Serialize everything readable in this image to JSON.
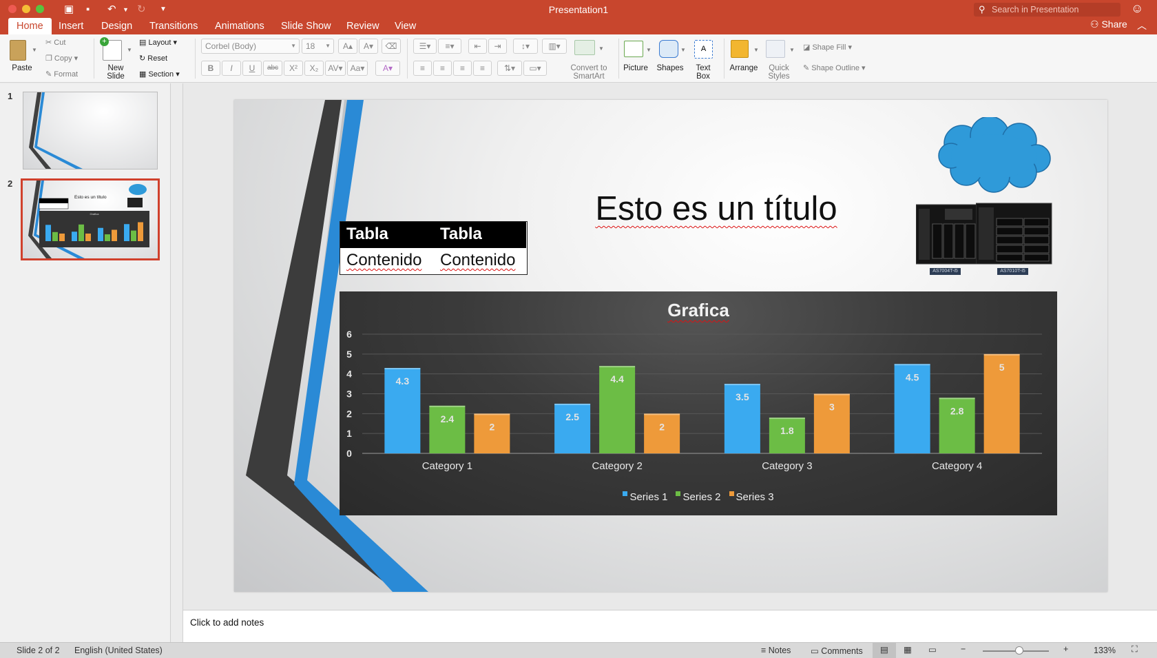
{
  "window": {
    "title": "Presentation1"
  },
  "search": {
    "placeholder": "Search in Presentation"
  },
  "tabs": [
    "Home",
    "Insert",
    "Design",
    "Transitions",
    "Animations",
    "Slide Show",
    "Review",
    "View"
  ],
  "share_label": "Share",
  "ribbon": {
    "paste": "Paste",
    "cut": "Cut",
    "copy": "Copy",
    "format": "Format",
    "new_slide_1": "New",
    "new_slide_2": "Slide",
    "layout": "Layout",
    "reset": "Reset",
    "section": "Section",
    "font_name": "Corbel (Body)",
    "font_size": "18",
    "convert_1": "Convert to",
    "convert_2": "SmartArt",
    "picture": "Picture",
    "shapes": "Shapes",
    "textbox_1": "Text",
    "textbox_2": "Box",
    "arrange": "Arrange",
    "quick_1": "Quick",
    "quick_2": "Styles",
    "shape_fill": "Shape Fill",
    "shape_outline": "Shape Outline",
    "bold": "B",
    "italic": "I",
    "underline": "U",
    "strike": "abc",
    "superscript": "X²",
    "subscript": "X₂"
  },
  "thumbnails": [
    {
      "number": "1"
    },
    {
      "number": "2",
      "title": "Esto es un título",
      "chart_title": "Grafica"
    }
  ],
  "slide": {
    "title": "Esto es un título",
    "table": {
      "headers": [
        "Tabla",
        "Tabla"
      ],
      "cells": [
        "Contenido",
        "Contenido"
      ]
    },
    "server_labels": [
      "AS7004T-i5",
      "AS7010T-i5"
    ]
  },
  "chart_data": {
    "type": "bar",
    "title": "Grafica",
    "categories": [
      "Category 1",
      "Category 2",
      "Category 3",
      "Category 4"
    ],
    "series": [
      {
        "name": "Series 1",
        "values": [
          4.3,
          2.5,
          3.5,
          4.5
        ],
        "color": "#3aaaf0"
      },
      {
        "name": "Series 2",
        "values": [
          2.4,
          4.4,
          1.8,
          2.8
        ],
        "color": "#6cbd45"
      },
      {
        "name": "Series 3",
        "values": [
          2,
          2,
          3,
          5
        ],
        "color": "#ee9a3a"
      }
    ],
    "ylim": [
      0,
      6
    ],
    "yticks": [
      "0",
      "1",
      "2",
      "3",
      "4",
      "5",
      "6"
    ],
    "grid": true,
    "legend_position": "bottom"
  },
  "notes": {
    "placeholder": "Click to add notes"
  },
  "status": {
    "slide": "Slide 2 of 2",
    "language": "English (United States)",
    "notes": "Notes",
    "comments": "Comments",
    "zoom": "133%"
  }
}
